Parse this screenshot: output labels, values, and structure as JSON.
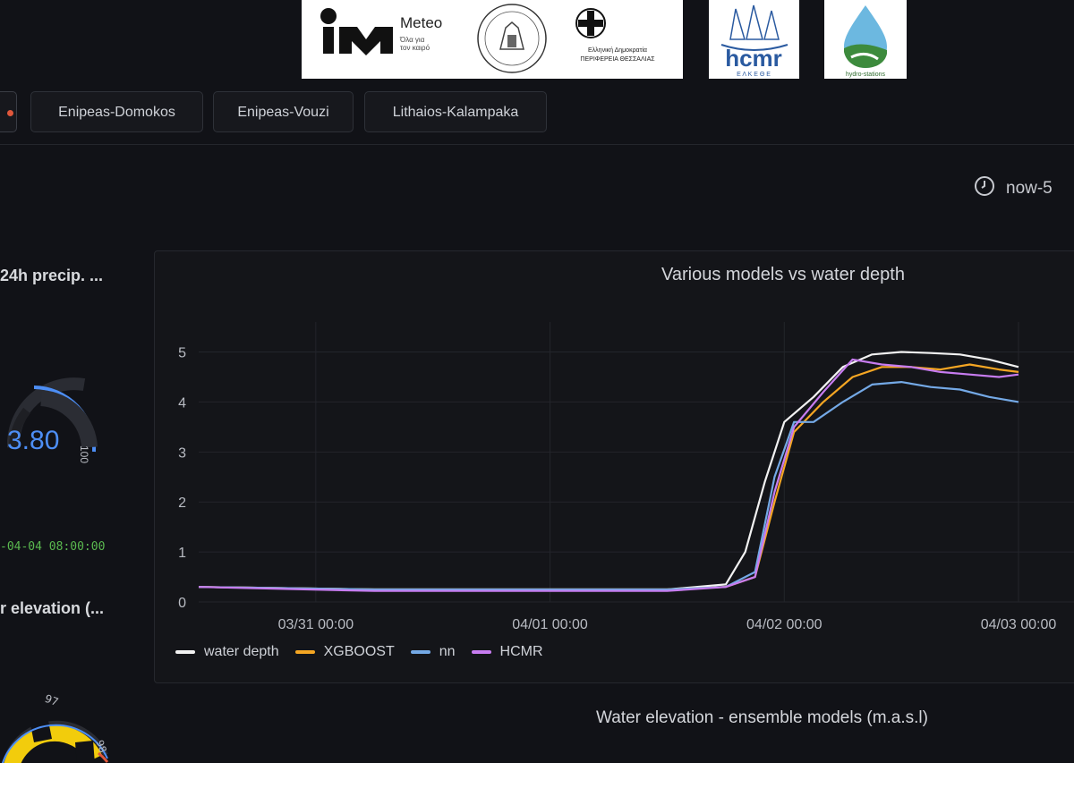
{
  "logos": {
    "meteo_name": "Meteo",
    "meteo_tagline": "Όλα για\nτον καιρό",
    "region_text": "Ελληνική Δημοκρατία\nΠΕΡΙΦΕΡΕΙΑ ΘΕΣΣΑΛΙΑΣ",
    "hcmr_text": "hcmr",
    "hcmr_sub": "Ε Λ Κ Ε Θ Ε",
    "hydro_text": "hydro-stations"
  },
  "tabs": [
    {
      "label": "Enipeas-Domokos"
    },
    {
      "label": "Enipeas-Vouzi"
    },
    {
      "label": "Lithaios-Kalampaka"
    }
  ],
  "time_range": "now-5",
  "left_panel": {
    "precip_title": "24h precip. ...",
    "gauge_value": "3.80",
    "gauge_max": "100",
    "timestamp": "-04-04 08:00:00",
    "elevation_title": "r elevation (...",
    "gauge2_tick_a": "97",
    "gauge2_tick_b": "98"
  },
  "colors": {
    "background": "#111217",
    "accent_blue": "#4d8ef5",
    "water_depth": "#f2f2f2",
    "xgboost": "#f5a623",
    "nn": "#74a9e6",
    "hcmr": "#c77cf0",
    "timestamp_green": "#5ab94f",
    "gauge2_yellow": "#f2cc0c"
  },
  "chart_data": {
    "type": "line",
    "title": "Various models vs water depth",
    "xlabel": "",
    "ylabel": "",
    "ylim": [
      0,
      5.6
    ],
    "xlim": [
      "2025-03-30T12:00",
      "2025-04-03T00:00"
    ],
    "x_ticks": [
      "03/31 00:00",
      "04/01 00:00",
      "04/02 00:00",
      "04/03 00:00"
    ],
    "y_ticks": [
      0,
      1,
      2,
      3,
      4,
      5
    ],
    "grid": true,
    "legend_position": "bottom-left",
    "series": [
      {
        "name": "water depth",
        "color": "#f2f2f2",
        "x": [
          "2025-03-30T12:00",
          "2025-03-31T06:00",
          "2025-04-01T12:00",
          "2025-04-01T18:00",
          "2025-04-01T20:00",
          "2025-04-01T22:00",
          "2025-04-02T00:00",
          "2025-04-02T03:00",
          "2025-04-02T06:00",
          "2025-04-02T09:00",
          "2025-04-02T12:00",
          "2025-04-02T15:00",
          "2025-04-02T18:00",
          "2025-04-02T21:00",
          "2025-04-03T00:00"
        ],
        "values": [
          0.3,
          0.25,
          0.25,
          0.35,
          1.0,
          2.4,
          3.6,
          4.1,
          4.7,
          4.95,
          5.0,
          4.98,
          4.95,
          4.85,
          4.7
        ]
      },
      {
        "name": "XGBOOST",
        "color": "#f5a623",
        "x": [
          "2025-03-30T12:00",
          "2025-03-31T06:00",
          "2025-04-01T12:00",
          "2025-04-01T18:00",
          "2025-04-01T21:00",
          "2025-04-01T23:00",
          "2025-04-02T01:00",
          "2025-04-02T04:00",
          "2025-04-02T07:00",
          "2025-04-02T10:00",
          "2025-04-02T13:00",
          "2025-04-02T16:00",
          "2025-04-02T19:00",
          "2025-04-02T22:00",
          "2025-04-03T00:00"
        ],
        "values": [
          0.3,
          0.25,
          0.25,
          0.3,
          0.5,
          2.0,
          3.4,
          4.0,
          4.5,
          4.7,
          4.7,
          4.65,
          4.75,
          4.65,
          4.6
        ]
      },
      {
        "name": "nn",
        "color": "#74a9e6",
        "x": [
          "2025-03-30T12:00",
          "2025-03-31T06:00",
          "2025-04-01T12:00",
          "2025-04-01T18:00",
          "2025-04-01T21:00",
          "2025-04-01T23:00",
          "2025-04-02T01:00",
          "2025-04-02T03:00",
          "2025-04-02T06:00",
          "2025-04-02T09:00",
          "2025-04-02T12:00",
          "2025-04-02T15:00",
          "2025-04-02T18:00",
          "2025-04-02T21:00",
          "2025-04-03T00:00"
        ],
        "values": [
          0.3,
          0.25,
          0.25,
          0.3,
          0.6,
          2.5,
          3.6,
          3.6,
          4.0,
          4.35,
          4.4,
          4.3,
          4.25,
          4.1,
          4.0
        ]
      },
      {
        "name": "HCMR",
        "color": "#c77cf0",
        "x": [
          "2025-03-30T12:00",
          "2025-03-31T06:00",
          "2025-04-01T12:00",
          "2025-04-01T18:00",
          "2025-04-01T21:00",
          "2025-04-01T23:00",
          "2025-04-02T01:00",
          "2025-04-02T04:00",
          "2025-04-02T07:00",
          "2025-04-02T10:00",
          "2025-04-02T13:00",
          "2025-04-02T16:00",
          "2025-04-02T19:00",
          "2025-04-02T22:00",
          "2025-04-03T00:00"
        ],
        "values": [
          0.3,
          0.22,
          0.22,
          0.3,
          0.5,
          2.2,
          3.5,
          4.2,
          4.85,
          4.75,
          4.7,
          4.6,
          4.55,
          4.5,
          4.55
        ]
      }
    ]
  },
  "ensemble_title": "Water elevation - ensemble models (m.a.s.l)"
}
